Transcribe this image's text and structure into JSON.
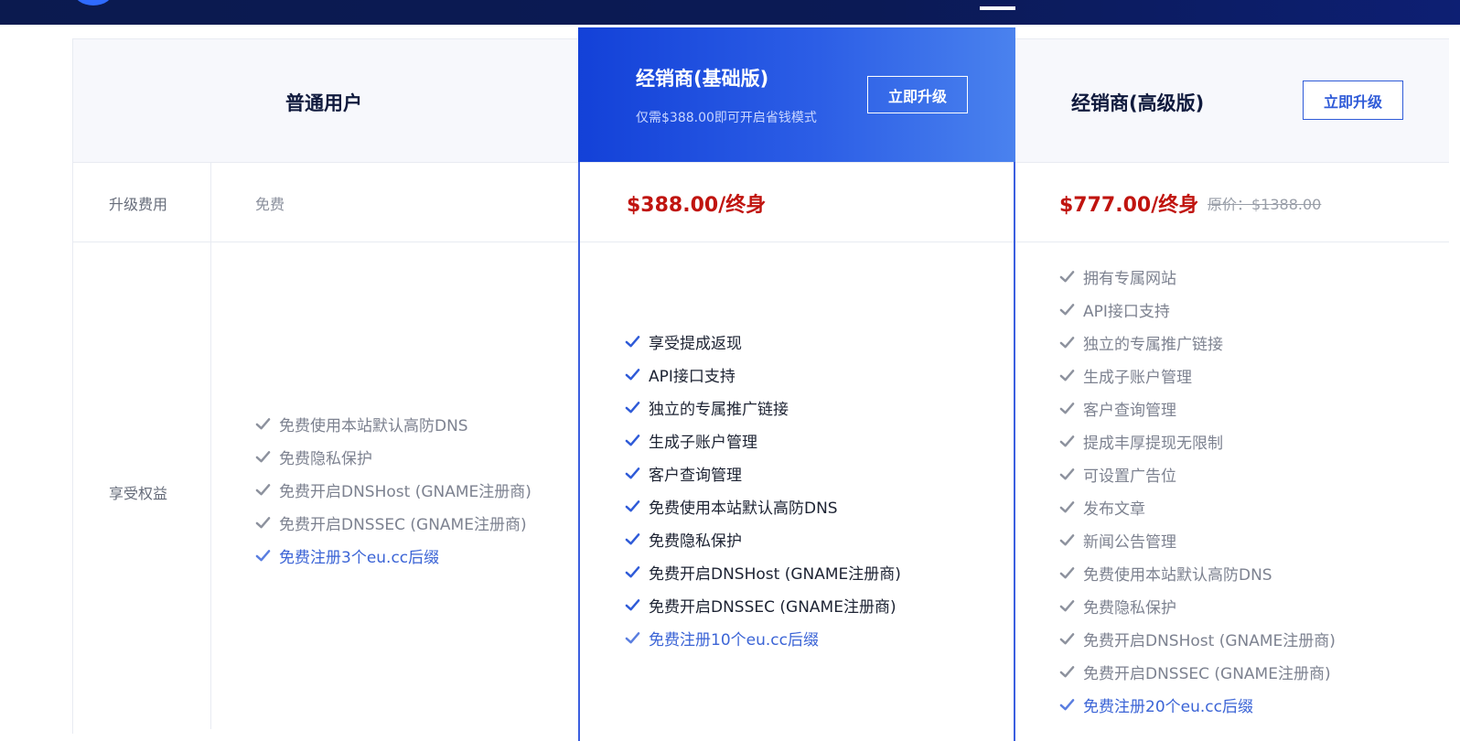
{
  "plans": {
    "normal": {
      "title": "普通用户"
    },
    "basic": {
      "title": "经销商(基础版)",
      "subtitle": "仅需$388.00即可开启省钱模式",
      "upgrade_label": "立即升级"
    },
    "premium": {
      "title": "经销商(高级版)",
      "upgrade_label": "立即升级"
    }
  },
  "rows": {
    "fee_label": "升级费用",
    "benefits_label": "享受权益"
  },
  "fees": {
    "normal": "免费",
    "basic": "$388.00/终身",
    "premium": "$777.00/终身",
    "premium_original": "原价：$1388.00"
  },
  "features": {
    "normal": [
      "免费使用本站默认高防DNS",
      "免费隐私保护",
      "免费开启DNSHost (GNAME注册商)",
      "免费开启DNSSEC (GNAME注册商)",
      "免费注册3个eu.cc后缀"
    ],
    "basic": [
      "享受提成返现",
      "API接口支持",
      "独立的专属推广链接",
      "生成子账户管理",
      "客户查询管理",
      "免费使用本站默认高防DNS",
      "免费隐私保护",
      "免费开启DNSHost (GNAME注册商)",
      "免费开启DNSSEC (GNAME注册商)",
      "免费注册10个eu.cc后缀"
    ],
    "premium": [
      "拥有专属网站",
      "API接口支持",
      "独立的专属推广链接",
      "生成子账户管理",
      "客户查询管理",
      "提成丰厚提现无限制",
      "可设置广告位",
      "发布文章",
      "新闻公告管理",
      "免费使用本站默认高防DNS",
      "免费隐私保护",
      "免费开启DNSHost (GNAME注册商)",
      "免费开启DNSSEC (GNAME注册商)",
      "免费注册20个eu.cc后缀"
    ]
  },
  "icons": {
    "feature_check": "check-icon"
  },
  "colors": {
    "header_dark": "#0b1a4f",
    "accent_blue": "#2f5bd8",
    "price_red": "#c0140f"
  }
}
